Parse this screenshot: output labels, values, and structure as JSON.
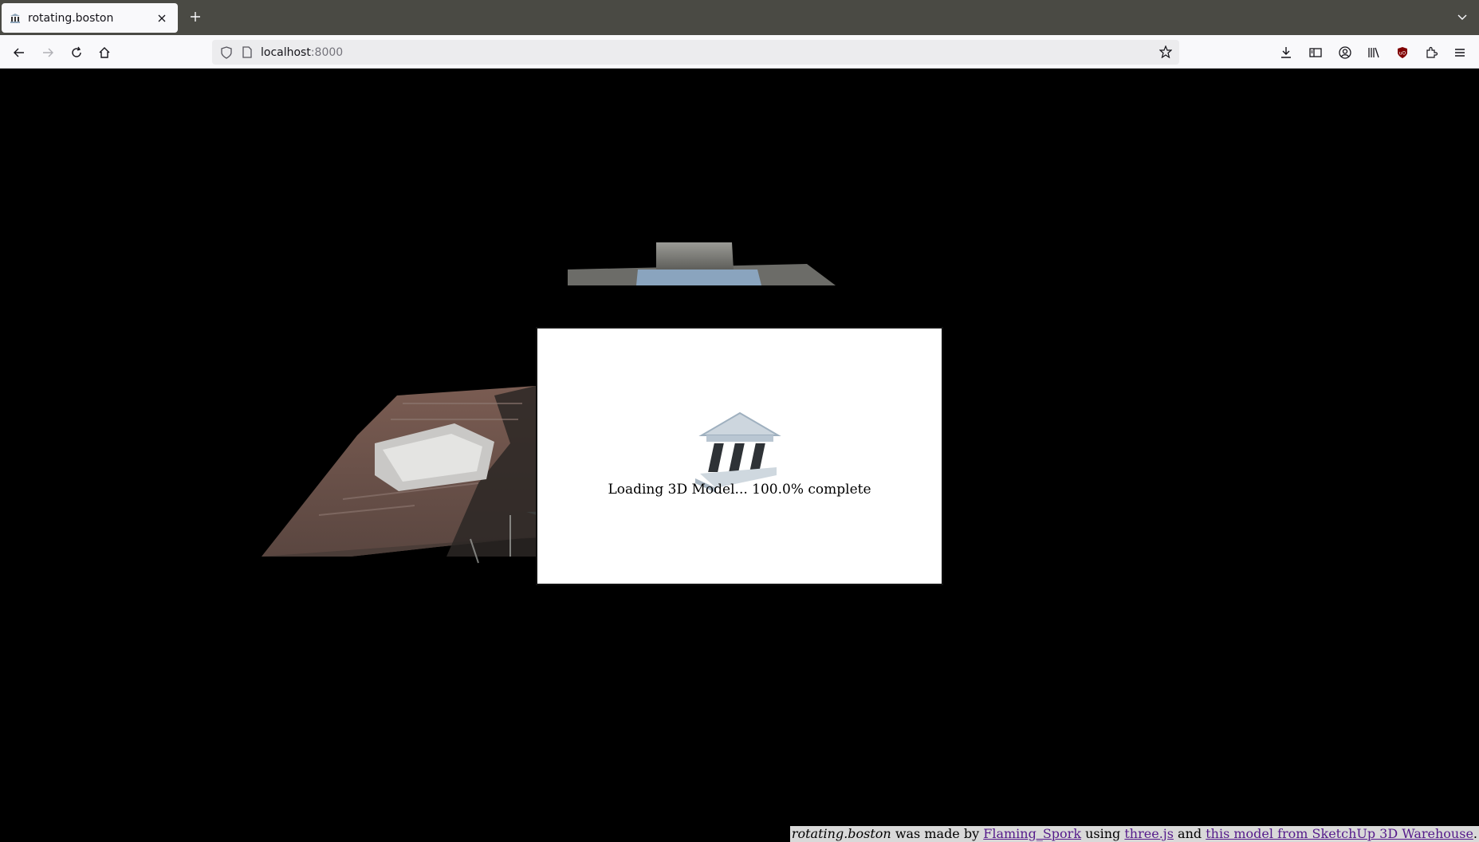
{
  "browser": {
    "tab": {
      "title": "rotating.boston",
      "favicon": "classical-building-icon"
    },
    "url": {
      "host": "localhost",
      "port": ":8000"
    }
  },
  "loading": {
    "text": "Loading 3D Model... 100.0% complete",
    "progress_percent": 100.0,
    "icon": "classical-building-icon"
  },
  "credit": {
    "site_name": "rotating.boston",
    "made_by": " was made by ",
    "author_link": "Flaming_Spork",
    "using": " using ",
    "lib_link": "three.js",
    "and": " and ",
    "model_link": "this model from SketchUp 3D Warehouse",
    "end": "."
  }
}
